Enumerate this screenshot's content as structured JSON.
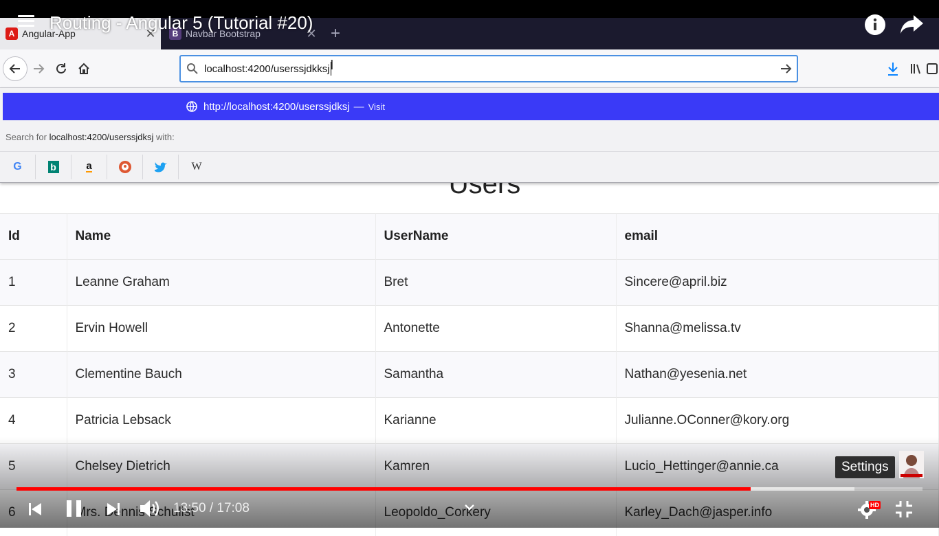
{
  "video": {
    "title": "Routing - Angular 5 (Tutorial #20)",
    "current_time": "13:50",
    "separator": " / ",
    "duration": "17:08",
    "progress_fraction": 0.81,
    "buffered_fraction": 0.925,
    "tooltip": "Settings",
    "hd_badge": "HD"
  },
  "browser": {
    "tabs": [
      {
        "title": "Angular-App",
        "favicon": "A",
        "favicon_color": "#dd1b16",
        "active": true
      },
      {
        "title": "Navbar Bootstrap",
        "favicon": "B",
        "favicon_color": "#563d7c",
        "active": false
      }
    ],
    "url": "localhost:4200/userssjdkksj",
    "suggestion": {
      "url": "http://localhost:4200/userssjdksj",
      "separator": "—",
      "action": "Visit"
    },
    "search_for": {
      "prefix": "Search for ",
      "query": "localhost:4200/userssjdksj",
      "suffix": " with:"
    },
    "engines": [
      "G",
      "b",
      "a",
      "",
      "",
      "W"
    ],
    "accent": "#3a3af7"
  },
  "page": {
    "heading": "Users",
    "table": {
      "headers": [
        "Id",
        "Name",
        "UserName",
        "email"
      ],
      "rows": [
        [
          "1",
          "Leanne Graham",
          "Bret",
          "Sincere@april.biz"
        ],
        [
          "2",
          "Ervin Howell",
          "Antonette",
          "Shanna@melissa.tv"
        ],
        [
          "3",
          "Clementine Bauch",
          "Samantha",
          "Nathan@yesenia.net"
        ],
        [
          "4",
          "Patricia Lebsack",
          "Karianne",
          "Julianne.OConner@kory.org"
        ],
        [
          "5",
          "Chelsey Dietrich",
          "Kamren",
          "Lucio_Hettinger@annie.ca"
        ],
        [
          "6",
          "Mrs. Dennis Schulist",
          "Leopoldo_Corkery",
          "Karley_Dach@jasper.info"
        ]
      ]
    }
  }
}
